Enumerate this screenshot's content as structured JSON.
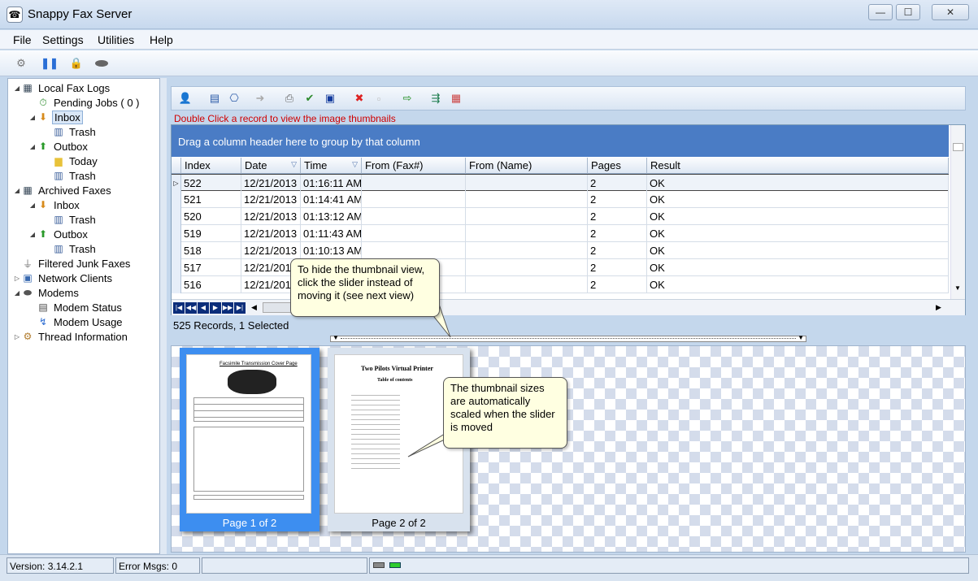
{
  "window": {
    "title": "Snappy Fax Server",
    "controls": [
      "—",
      "☐",
      "✕"
    ]
  },
  "menu": [
    "File",
    "Settings",
    "Utilities",
    "Help"
  ],
  "tree": {
    "items": [
      {
        "label": "Local Fax Logs",
        "level": 0,
        "icon": "fax-log-icon",
        "expand": "◢"
      },
      {
        "label": "Pending Jobs ( 0 )",
        "level": 1,
        "icon": "pending-icon",
        "expand": ""
      },
      {
        "label": "Inbox",
        "level": 1,
        "icon": "inbox-icon",
        "expand": "◢",
        "selected": true
      },
      {
        "label": "Trash",
        "level": 2,
        "icon": "trash-icon",
        "expand": ""
      },
      {
        "label": "Outbox",
        "level": 1,
        "icon": "outbox-icon",
        "expand": "◢"
      },
      {
        "label": "Today",
        "level": 2,
        "icon": "folder-icon",
        "expand": ""
      },
      {
        "label": "Trash",
        "level": 2,
        "icon": "trash-icon",
        "expand": ""
      },
      {
        "label": "Archived Faxes",
        "level": 0,
        "icon": "archive-icon",
        "expand": "◢"
      },
      {
        "label": "Inbox",
        "level": 1,
        "icon": "inbox-icon",
        "expand": "◢"
      },
      {
        "label": "Trash",
        "level": 2,
        "icon": "trash-icon",
        "expand": ""
      },
      {
        "label": "Outbox",
        "level": 1,
        "icon": "outbox-icon",
        "expand": "◢"
      },
      {
        "label": "Trash",
        "level": 2,
        "icon": "trash-icon",
        "expand": ""
      },
      {
        "label": "Filtered Junk Faxes",
        "level": 0,
        "icon": "filter-icon",
        "expand": ""
      },
      {
        "label": "Network Clients",
        "level": 0,
        "icon": "network-icon",
        "expand": "▷"
      },
      {
        "label": "Modems",
        "level": 0,
        "icon": "modem-icon",
        "expand": "◢"
      },
      {
        "label": "Modem  Status",
        "level": 1,
        "icon": "modem-status-icon",
        "expand": ""
      },
      {
        "label": "Modem  Usage",
        "level": 1,
        "icon": "modem-usage-icon",
        "expand": ""
      },
      {
        "label": "Thread Information",
        "level": 0,
        "icon": "thread-icon",
        "expand": "▷"
      }
    ]
  },
  "grid": {
    "hint": "Double Click a record to view the image thumbnails",
    "group_hint": "Drag a column header here to group by that column",
    "columns": [
      "Index",
      "Date",
      "Time",
      "From (Fax#)",
      "From (Name)",
      "Pages",
      "Result"
    ],
    "rows": [
      [
        "522",
        "12/21/2013",
        "01:16:11 AM",
        "",
        "",
        "2",
        "OK"
      ],
      [
        "521",
        "12/21/2013",
        "01:14:41 AM",
        "",
        "",
        "2",
        "OK"
      ],
      [
        "520",
        "12/21/2013",
        "01:13:12 AM",
        "",
        "",
        "2",
        "OK"
      ],
      [
        "519",
        "12/21/2013",
        "01:11:43 AM",
        "",
        "",
        "2",
        "OK"
      ],
      [
        "518",
        "12/21/2013",
        "01:10:13 AM",
        "",
        "",
        "2",
        "OK"
      ],
      [
        "517",
        "12/21/2013",
        "",
        "",
        "",
        "2",
        "OK"
      ],
      [
        "516",
        "12/21/2013",
        "",
        "",
        "",
        "2",
        "OK"
      ]
    ],
    "records": "525 Records, 1 Selected"
  },
  "thumbs": [
    {
      "caption": "Page 1 of 2",
      "selected": true
    },
    {
      "caption": "Page 2 of 2",
      "selected": false
    }
  ],
  "page2": {
    "title": "Two Pilots Virtual Printer",
    "subtitle": "Table of contents"
  },
  "page1": {
    "title": "Facsimile Transmission Cover Page"
  },
  "callouts": {
    "hide": "To hide the thumbnail view, click the slider instead of moving it (see next view)",
    "scale": "The thumbnail sizes are automatically scaled when the slider is moved"
  },
  "status": {
    "version": "Version: 3.14.2.1",
    "errors": "Error Msgs: 0"
  },
  "colors": {
    "group_bar": "#4a7cc5",
    "hint": "#d00000",
    "thumb_selected": "#3d8ef0"
  }
}
